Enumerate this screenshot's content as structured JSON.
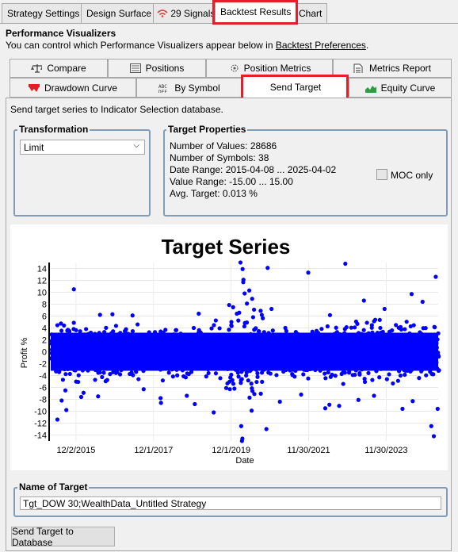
{
  "top_tabs": [
    "Strategy Settings",
    "Design Surface",
    "29 Signals",
    "Backtest Results",
    "Chart"
  ],
  "header": {
    "title": "Performance Visualizers",
    "desc_prefix": "You can control which Performance Visualizers appear below in ",
    "desc_link": "Backtest Preferences",
    "desc_suffix": "."
  },
  "visualizer_tabs": {
    "row1": [
      "Compare",
      "Positions",
      "Position Metrics",
      "Metrics Report"
    ],
    "row2": [
      "Drawdown Curve",
      "By Symbol",
      "Send Target",
      "Equity Curve"
    ]
  },
  "intro_text": "Send target series to Indicator Selection database.",
  "transformation": {
    "label": "Transformation",
    "selected": "Limit"
  },
  "target_properties": {
    "label": "Target Properties",
    "lines": [
      "Number of Values: 28686",
      "Number of Symbols: 38",
      "Date Range: 2015-04-08 ... 2025-04-02",
      "Value Range: -15.00 ... 15.00",
      "Avg. Target: 0.013 %"
    ],
    "moc_label": "MOC only",
    "moc_checked": false
  },
  "chart_data": {
    "type": "scatter",
    "title": "Target Series",
    "xlabel": "Date",
    "ylabel": "Profit %",
    "xlim": [
      "2015-04-08",
      "2025-04-02"
    ],
    "ylim": [
      -15,
      15
    ],
    "yticks": [
      14,
      12,
      10,
      8,
      6,
      4,
      2,
      0,
      -2,
      -4,
      -6,
      -8,
      -10,
      -12,
      -14
    ],
    "xticks": [
      "12/2/2015",
      "12/1/2017",
      "12/1/2019",
      "11/30/2021",
      "11/30/2023"
    ],
    "color": "#0000ff",
    "points": [
      [
        "2015-06-10",
        -11.4
      ],
      [
        "2015-07-20",
        -8.2
      ],
      [
        "2015-08-24",
        -6.5
      ],
      [
        "2015-09-02",
        -9.8
      ],
      [
        "2015-11-12",
        10.5
      ],
      [
        "2016-01-20",
        -7.6
      ],
      [
        "2016-02-11",
        -6.9
      ],
      [
        "2016-06-27",
        -7.5
      ],
      [
        "2016-07-15",
        6.2
      ],
      [
        "2016-11-09",
        6.3
      ],
      [
        "2017-05-17",
        6.1
      ],
      [
        "2017-08-30",
        -6.3
      ],
      [
        "2018-02-05",
        -7.8
      ],
      [
        "2018-02-09",
        -8.6
      ],
      [
        "2018-10-10",
        -7.4
      ],
      [
        "2018-12-24",
        -8.8
      ],
      [
        "2019-01-30",
        6.4
      ],
      [
        "2019-06-20",
        -10.2
      ],
      [
        "2019-10-16",
        -6.1
      ],
      [
        "2020-02-27",
        15.0
      ],
      [
        "2020-03-05",
        -12.5
      ],
      [
        "2020-03-12",
        -15.0
      ],
      [
        "2020-03-16",
        -14.6
      ],
      [
        "2020-03-18",
        13.9
      ],
      [
        "2020-03-24",
        11.7
      ],
      [
        "2020-03-26",
        12.1
      ],
      [
        "2020-04-06",
        9.8
      ],
      [
        "2020-04-28",
        8.1
      ],
      [
        "2020-05-20",
        10.3
      ],
      [
        "2020-06-11",
        -9.9
      ],
      [
        "2020-06-16",
        8.9
      ],
      [
        "2020-10-28",
        -13.0
      ],
      [
        "2020-11-09",
        14.1
      ],
      [
        "2020-12-15",
        7.2
      ],
      [
        "2021-03-04",
        -8.4
      ],
      [
        "2021-09-20",
        -7.2
      ],
      [
        "2021-11-26",
        13.3
      ],
      [
        "2022-05-05",
        -9.5
      ],
      [
        "2022-06-13",
        -8.9
      ],
      [
        "2022-09-13",
        -9.1
      ],
      [
        "2022-11-10",
        14.8
      ],
      [
        "2023-03-13",
        -8.1
      ],
      [
        "2023-05-04",
        8.6
      ],
      [
        "2023-08-07",
        -7.4
      ],
      [
        "2023-11-14",
        7.2
      ],
      [
        "2024-05-01",
        -9.6
      ],
      [
        "2024-07-26",
        9.7
      ],
      [
        "2024-08-05",
        -8.3
      ],
      [
        "2024-11-06",
        8.4
      ],
      [
        "2025-01-27",
        -12.5
      ],
      [
        "2025-02-20",
        -14.2
      ],
      [
        "2025-03-10",
        12.6
      ],
      [
        "2025-03-28",
        -9.6
      ]
    ]
  },
  "name_of_target": {
    "label": "Name of Target",
    "value": "Tgt_DOW 30;WealthData_Untitled Strategy"
  },
  "send_button_label": "Send Target to Database"
}
